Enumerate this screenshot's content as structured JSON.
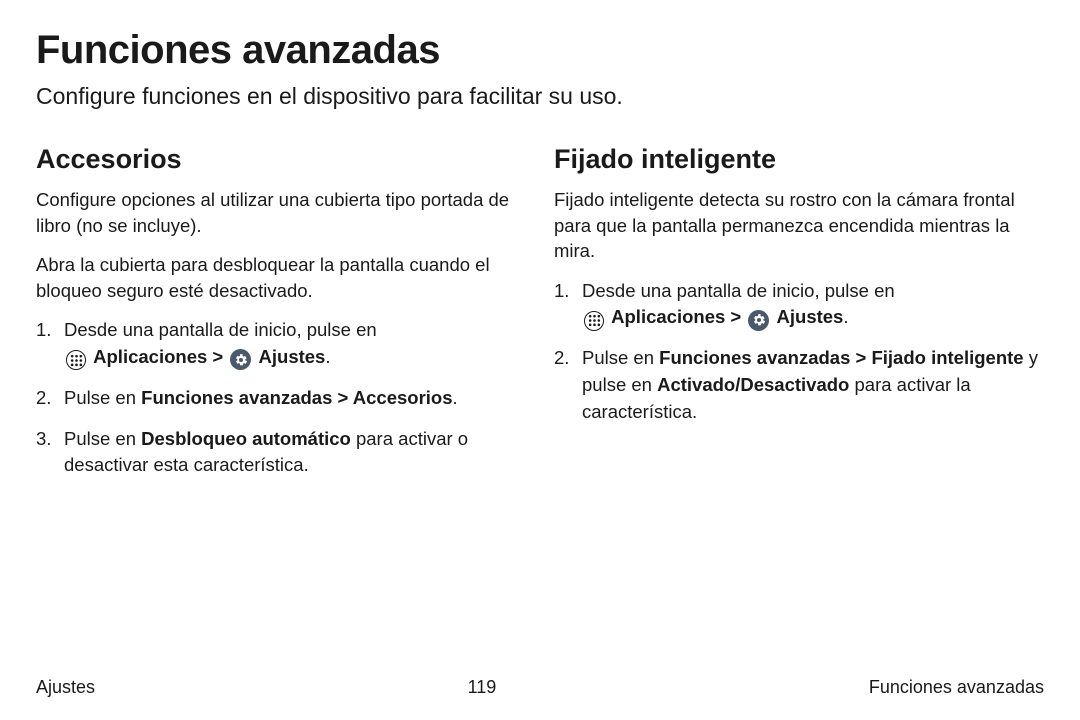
{
  "title": "Funciones avanzadas",
  "intro": "Configure funciones en el dispositivo para facilitar su uso.",
  "left": {
    "heading": "Accesorios",
    "p1": "Configure opciones al utilizar una cubierta tipo portada de libro (no se incluye).",
    "p2": "Abra la cubierta para desbloquear la pantalla cuando el bloqueo seguro esté desactivado.",
    "step1_pre": "Desde una pantalla de inicio, pulse en ",
    "apps_label": "Aplicaciones",
    "sep": " > ",
    "settings_label": "Ajustes",
    "period": ".",
    "step2_pre": "Pulse en ",
    "step2_bold": "Funciones avanzadas > Accesorios",
    "step3_pre": "Pulse en ",
    "step3_bold": "Desbloqueo automático",
    "step3_post": " para activar o desactivar esta característica."
  },
  "right": {
    "heading": "Fijado inteligente",
    "p1": "Fijado inteligente detecta su rostro con la cámara frontal para que la pantalla permanezca encendida mientras la mira.",
    "step1_pre": "Desde una pantalla de inicio, pulse en ",
    "apps_label": "Aplicaciones",
    "sep": " > ",
    "settings_label": "Ajustes",
    "period": ".",
    "step2_pre": "Pulse en ",
    "step2_bold": "Funciones avanzadas > Fijado inteligente",
    "step2_mid": " y pulse en ",
    "step2_bold2": "Activado/Desactivado",
    "step2_post": " para activar la característica."
  },
  "footer": {
    "left": "Ajustes",
    "center": "119",
    "right": "Funciones avanzadas"
  }
}
